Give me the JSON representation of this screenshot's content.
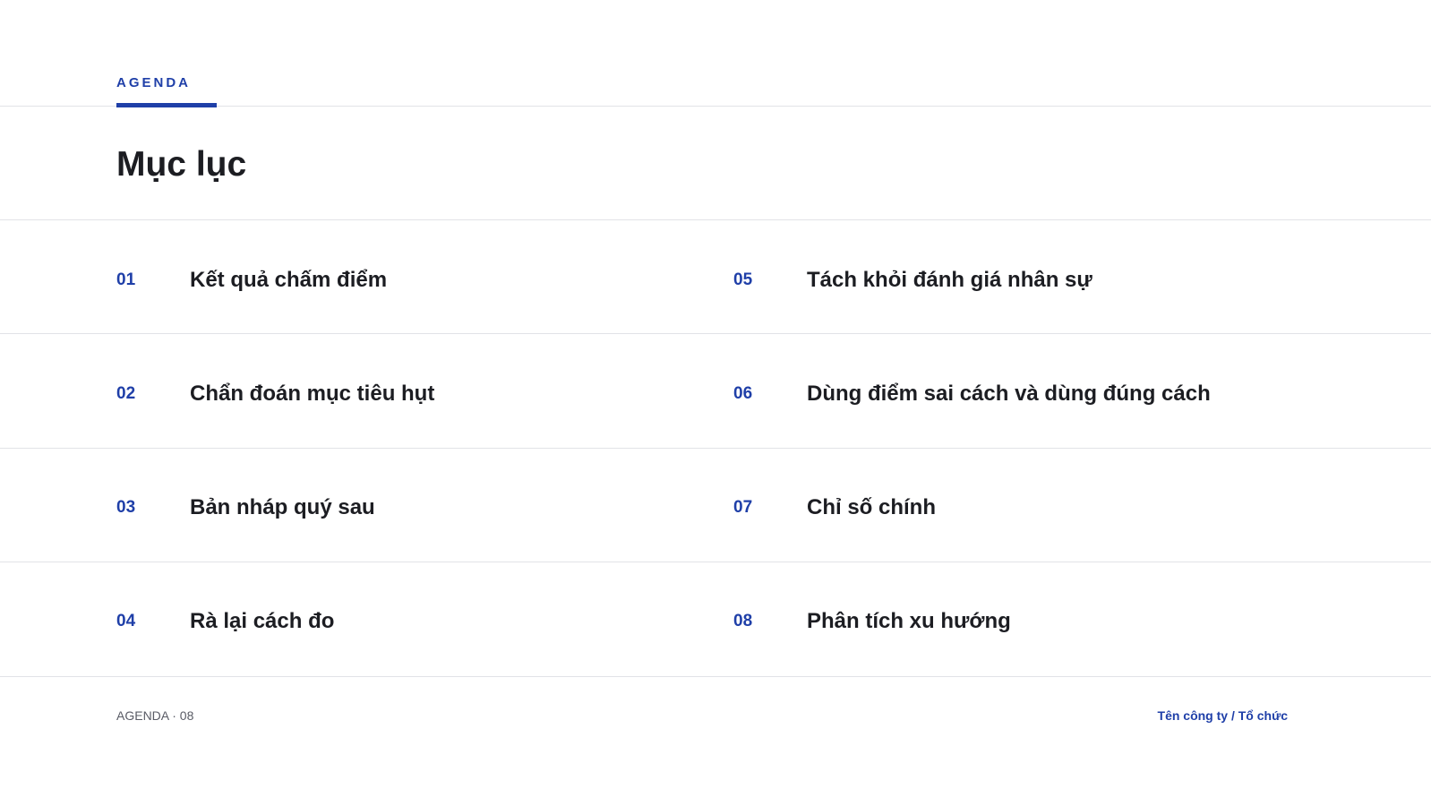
{
  "header": {
    "section_label": "AGENDA",
    "title": "Mục lục"
  },
  "agenda": {
    "items": [
      {
        "number": "01",
        "label": "Kết quả chấm điểm"
      },
      {
        "number": "02",
        "label": "Chẩn đoán mục tiêu hụt"
      },
      {
        "number": "03",
        "label": "Bản nháp quý sau"
      },
      {
        "number": "04",
        "label": "Rà lại cách đo"
      },
      {
        "number": "05",
        "label": "Tách khỏi đánh giá nhân sự"
      },
      {
        "number": "06",
        "label": "Dùng điểm sai cách và dùng đúng cách"
      },
      {
        "number": "07",
        "label": "Chỉ số chính"
      },
      {
        "number": "08",
        "label": "Phân tích xu hướng"
      }
    ]
  },
  "footer": {
    "left_text": "AGENDA · 08",
    "right_text": "Tên công ty / Tổ chức"
  },
  "colors": {
    "accent": "#1f3fa8",
    "text": "#1c1d22",
    "rule": "#e2e3e7",
    "muted": "#5a5c66"
  }
}
